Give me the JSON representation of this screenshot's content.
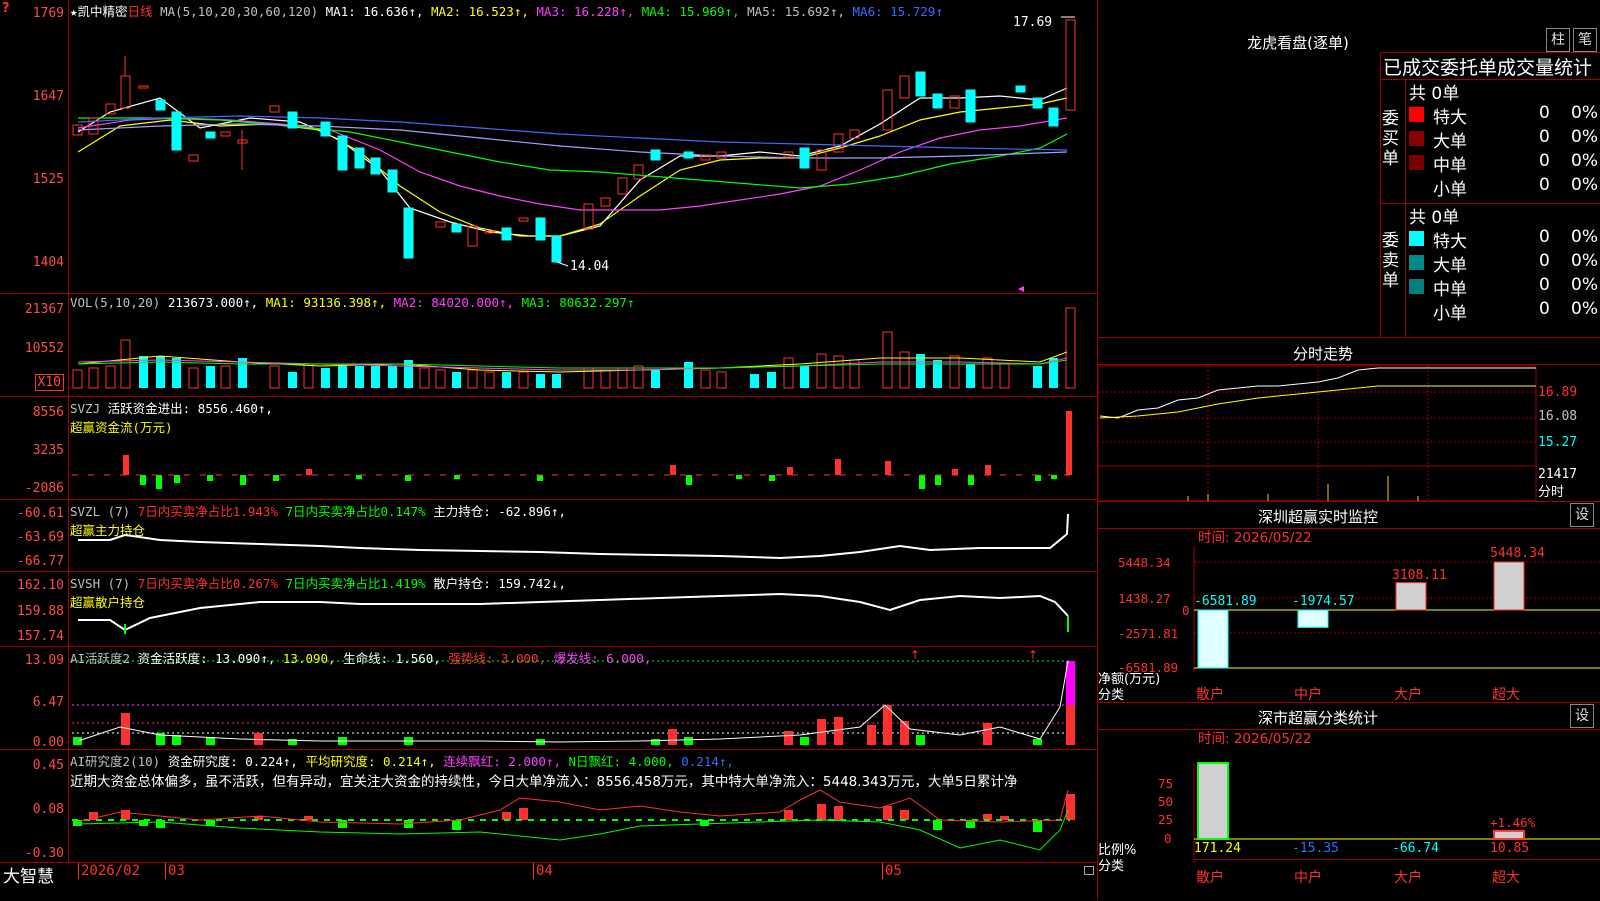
{
  "stock": {
    "name": "★凯中精密",
    "period": "日线"
  },
  "main": {
    "ma_title": "MA(5,10,20,30,60,120)",
    "ma1": "MA1: 16.636↑,",
    "ma2": "MA2: 16.523↑,",
    "ma3": "MA3: 16.228↑,",
    "ma4": "MA4: 15.969↑,",
    "ma5": "MA5: 15.692↑,",
    "ma6": "MA6: 15.729↑",
    "y_labels": [
      "1769",
      "1647",
      "1525",
      "1404"
    ],
    "high_marker": "17.69",
    "low_marker": "14.04",
    "corner_mark": "?"
  },
  "vol": {
    "title": "VOL(5,10,20)",
    "value": "213673.000↑,",
    "ma1": "MA1: 93136.398↑,",
    "ma2": "MA2: 84020.000↑,",
    "ma3": "MA3: 80632.297↑",
    "y_labels": [
      "21367",
      "10552"
    ],
    "unit": "X10"
  },
  "svzj": {
    "title": "SVZJ",
    "value": "活跃资金进出: 8556.460↑,",
    "subtitle": "超赢资金流(万元)",
    "y_labels": [
      "8556",
      "3235",
      "-2086"
    ]
  },
  "svzl": {
    "title": "SVZL (7)",
    "t1": "7日内买卖净占比1.943%",
    "t2": "7日内买卖净占比0.147%",
    "t3": "主力持仓: -62.896↑,",
    "subtitle": "超赢主力持仓",
    "y_labels": [
      "-60.61",
      "-63.69",
      "-66.77"
    ]
  },
  "svsh": {
    "title": "SVSH (7)",
    "t1": "7日内买卖净占比0.267%",
    "t2": "7日内买卖净占比1.419%",
    "t3": "散户持仓: 159.742↓,",
    "subtitle": "超赢散户持仓",
    "y_labels": [
      "162.10",
      "159.88",
      "157.74"
    ]
  },
  "ai_active": {
    "title": "AI活跃度2",
    "t1": "资金活跃度: 13.090↑,",
    "t2": "13.090,",
    "t3": "生命线: 1.560,",
    "t4": "强势线: 3.000,",
    "t5": "爆发线: 6.000,",
    "y_labels": [
      "13.09",
      "6.47",
      "0.00"
    ]
  },
  "ai_research": {
    "title": "AI研究度2(10)",
    "t1": "资金研究度: 0.224↑,",
    "t2": "平均研究度: 0.214↑,",
    "t3": "连续飘红: 2.000↑,",
    "t4": "N日飘红: 4.000,",
    "t5": "0.214↑,",
    "note": "近期大资金总体偏多，虽不活跃，但有异动，宜关注大资金的持续性，今日大单净流入：8556.458万元，其中特大单净流入：5448.343万元，大单5日累计净",
    "y_labels": [
      "0.45",
      "0.08",
      "-0.30"
    ]
  },
  "footer": {
    "brand": "大智慧",
    "dates": [
      "2026/02",
      "03",
      "04",
      "05"
    ]
  },
  "dragon": {
    "title": "龙虎看盘(逐单)",
    "btn1": "柱",
    "btn2": "笔",
    "header": "已成交委托单成交量统计",
    "buy_label": "委买单",
    "sell_label": "委卖单",
    "buy_total": "共 0单",
    "sell_total": "共 0单",
    "buy_rows": [
      {
        "name": "特大",
        "count": "0",
        "pct": "0%",
        "color": "#ff0000"
      },
      {
        "name": "大单",
        "count": "0",
        "pct": "0%",
        "color": "#8b0000"
      },
      {
        "name": "中单",
        "count": "0",
        "pct": "0%",
        "color": "#7a0000"
      },
      {
        "name": "小单",
        "count": "0",
        "pct": "0%",
        "color": ""
      }
    ],
    "sell_rows": [
      {
        "name": "特大",
        "count": "0",
        "pct": "0%",
        "color": "#00ffff"
      },
      {
        "name": "大单",
        "count": "0",
        "pct": "0%",
        "color": "#008b8b"
      },
      {
        "name": "中单",
        "count": "0",
        "pct": "0%",
        "color": "#007f7f"
      },
      {
        "name": "小单",
        "count": "0",
        "pct": "0%",
        "color": ""
      }
    ]
  },
  "intraday": {
    "title": "分时走势",
    "labels": [
      "16.89",
      "16.08",
      "15.27",
      "21417",
      "分时"
    ]
  },
  "monitor": {
    "title": "深圳超赢实时监控",
    "btn": "设",
    "time": "时间: 2026/05/22",
    "y_labels": [
      "5448.34",
      "1438.27",
      "0",
      "-2571.81",
      "-6581.89"
    ],
    "axis_label1": "净额(万元)",
    "axis_label2": "分类",
    "categories": [
      "散户",
      "中户",
      "大户",
      "超大"
    ],
    "values": [
      -6581.89,
      -1974.57,
      3108.11,
      5448.34
    ],
    "value_labels": [
      "-6581.89",
      "-1974.57",
      "3108.11",
      "5448.34"
    ]
  },
  "classify": {
    "title": "深市超赢分类统计",
    "btn": "设",
    "time": "时间: 2026/05/22",
    "y_labels": [
      "75",
      "50",
      "25",
      "0"
    ],
    "axis_label1": "比例%",
    "axis_label2": "分类",
    "categories": [
      "散户",
      "中户",
      "大户",
      "超大"
    ],
    "values": [
      171.24,
      -15.35,
      -66.74,
      10.85
    ],
    "value_labels": [
      "171.24",
      "-15.35",
      "-66.74",
      "10.85"
    ],
    "extra_label": "+1.46%"
  }
}
